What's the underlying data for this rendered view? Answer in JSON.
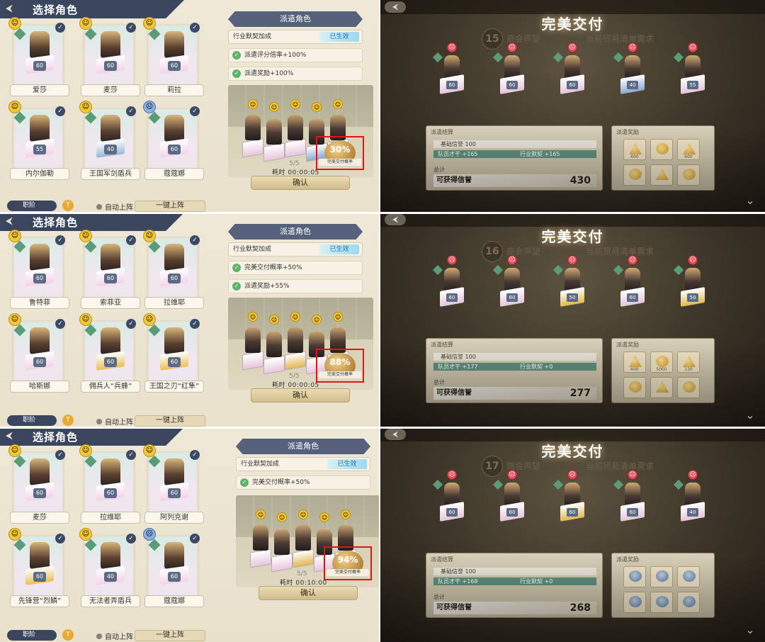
{
  "strips": [
    {
      "title": "选择角色",
      "cards": [
        {
          "name": "爱莎",
          "emo": "happy",
          "ped": "pink",
          "lv": "60"
        },
        {
          "name": "麦莎",
          "emo": "happy",
          "ped": "pink",
          "lv": "60"
        },
        {
          "name": "莉拉",
          "emo": "happy",
          "ped": "pink",
          "lv": "60"
        },
        {
          "name": "内尔伽勒",
          "emo": "happy",
          "ped": "pink",
          "lv": "55"
        },
        {
          "name": "王国军剑盾兵",
          "emo": "happy",
          "ped": "blue",
          "lv": "40"
        },
        {
          "name": "蔻蔻娜",
          "emo": "sad",
          "ped": "pink",
          "lv": "60"
        }
      ],
      "role": "职阶",
      "auto": "自动上阵",
      "one": "一键上阵",
      "dispatch_title": "派遣角色",
      "bonus": "行业默契加成",
      "effective": "已生效",
      "buffs": [
        "派遣评分倍率+100%",
        "派遣奖励+100%"
      ],
      "prob": "30%",
      "prob_label": "完美交付概率",
      "count": "5/5",
      "time": "耗时 00:00:05",
      "confirm": "确认",
      "right": {
        "title": "完美交付",
        "round": "15",
        "rep": "商会声望",
        "req": "当前贸易清单需求",
        "chars": [
          {
            "lv": "60",
            "ped": "pink"
          },
          {
            "lv": "60",
            "ped": "pink"
          },
          {
            "lv": "60",
            "ped": "pink"
          },
          {
            "lv": "40",
            "ped": "blue"
          },
          {
            "lv": "55",
            "ped": "pink"
          }
        ],
        "settle_title": "派遣结算",
        "base": "基础信誉 100",
        "bar1": "队员才干 +165",
        "bar2": "行业默契 +165",
        "total": "总计",
        "gain": "可获得信誉",
        "gain_val": "430",
        "reward_title": "派遣奖励",
        "rewards": [
          {
            "q": "600",
            "t": "tri"
          },
          {
            "q": "",
            "t": "coin"
          },
          {
            "q": "600",
            "t": "tri"
          },
          {
            "q": "",
            "t": "coin"
          },
          {
            "q": "",
            "t": "tri"
          },
          {
            "q": "",
            "t": "coin"
          }
        ]
      }
    },
    {
      "title": "选择角色",
      "cards": [
        {
          "name": "鲁特菲",
          "emo": "happy",
          "ped": "pink",
          "lv": "60"
        },
        {
          "name": "索菲亚",
          "emo": "happy",
          "ped": "pink",
          "lv": "60"
        },
        {
          "name": "拉维耶",
          "emo": "happy",
          "ped": "pink",
          "lv": "60"
        },
        {
          "name": "哈斯娜",
          "emo": "happy",
          "ped": "pink",
          "lv": "60"
        },
        {
          "name": "佣兵人“兵蜂”",
          "emo": "happy",
          "ped": "gold",
          "lv": "60"
        },
        {
          "name": "王国之刃“红隼”",
          "emo": "happy",
          "ped": "gold",
          "lv": "60"
        }
      ],
      "role": "职阶",
      "auto": "自动上阵",
      "one": "一键上阵",
      "dispatch_title": "派遣角色",
      "bonus": "行业默契加成",
      "effective": "已生效",
      "buffs": [
        "完美交付概率+50%",
        "派遣奖励+55%"
      ],
      "prob": "88%",
      "prob_label": "完美交付概率",
      "count": "5/5",
      "time": "耗时 00:00:05",
      "confirm": "确认",
      "right": {
        "title": "完美交付",
        "round": "16",
        "rep": "商会声望",
        "req": "当前贸易清单需求",
        "chars": [
          {
            "lv": "60",
            "ped": "pink"
          },
          {
            "lv": "60",
            "ped": "pink"
          },
          {
            "lv": "50",
            "ped": "gold"
          },
          {
            "lv": "60",
            "ped": "pink"
          },
          {
            "lv": "50",
            "ped": "gold"
          }
        ],
        "settle_title": "派遣结算",
        "base": "基础信誉 100",
        "bar1": "队员才干 +177",
        "bar2": "行业默契 +0",
        "total": "总计",
        "gain": "可获得信誉",
        "gain_val": "277",
        "reward_title": "派遣奖励",
        "rewards": [
          {
            "q": "600",
            "t": "tri"
          },
          {
            "q": "5000",
            "t": "coin"
          },
          {
            "q": "130",
            "t": "tri"
          },
          {
            "q": "",
            "t": "coin"
          },
          {
            "q": "",
            "t": "tri"
          },
          {
            "q": "",
            "t": "coin"
          }
        ]
      }
    },
    {
      "title": "选择角色",
      "cards": [
        {
          "name": "麦莎",
          "emo": "happy",
          "ped": "pink",
          "lv": "60"
        },
        {
          "name": "拉维耶",
          "emo": "happy",
          "ped": "pink",
          "lv": "60"
        },
        {
          "name": "阿列克谢",
          "emo": "happy",
          "ped": "pink",
          "lv": "60"
        },
        {
          "name": "先锋营“烈鳞”",
          "emo": "happy",
          "ped": "gold",
          "lv": "60"
        },
        {
          "name": "无法者弄盾兵",
          "emo": "happy",
          "ped": "pink",
          "lv": "40"
        },
        {
          "name": "蔻蔻娜",
          "emo": "sad",
          "ped": "pink",
          "lv": "60"
        }
      ],
      "role": "职阶",
      "auto": "自动上阵",
      "one": "一键上阵",
      "dispatch_title": "派遣角色",
      "bonus": "行业默契加成",
      "effective": "已生效",
      "buffs": [
        "完美交付概率+50%"
      ],
      "prob": "94%",
      "prob_label": "完美交付概率",
      "count": "5/5",
      "time": "耗时 00:10:00",
      "confirm": "确认",
      "right": {
        "title": "完美交付",
        "round": "17",
        "rep": "商会声望",
        "req": "当前贸易清单需求",
        "chars": [
          {
            "lv": "60",
            "ped": "pink"
          },
          {
            "lv": "60",
            "ped": "pink"
          },
          {
            "lv": "60",
            "ped": "gold"
          },
          {
            "lv": "60",
            "ped": "pink"
          },
          {
            "lv": "40",
            "ped": "pink"
          }
        ],
        "settle_title": "派遣结算",
        "base": "基础信誉 100",
        "bar1": "队员才干 +168",
        "bar2": "行业默契 +0",
        "total": "总计",
        "gain": "可获得信誉",
        "gain_val": "268",
        "reward_title": "派遣奖励",
        "rewards": [
          {
            "q": "",
            "t": "face"
          },
          {
            "q": "",
            "t": "face"
          },
          {
            "q": "",
            "t": "face"
          },
          {
            "q": "",
            "t": "face"
          },
          {
            "q": "",
            "t": "face"
          },
          {
            "q": "",
            "t": "face"
          }
        ]
      }
    }
  ]
}
